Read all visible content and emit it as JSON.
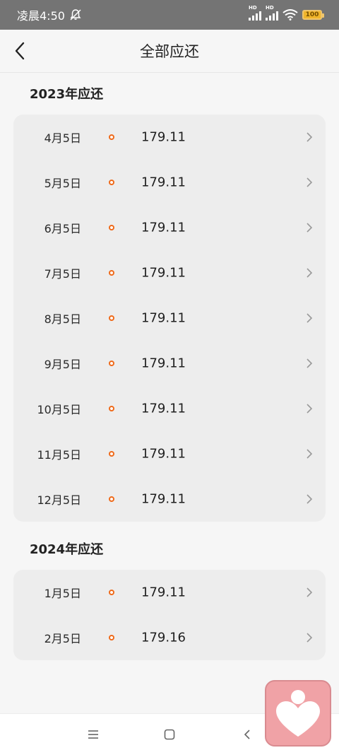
{
  "status_bar": {
    "time": "凌晨4:50",
    "signal_1_label": "HD",
    "signal_2_label": "HD",
    "battery": "100"
  },
  "header": {
    "title": "全部应还"
  },
  "sections": [
    {
      "title": "2023年应还",
      "rows": [
        {
          "date": "4月5日",
          "amount": "179.11"
        },
        {
          "date": "5月5日",
          "amount": "179.11"
        },
        {
          "date": "6月5日",
          "amount": "179.11"
        },
        {
          "date": "7月5日",
          "amount": "179.11"
        },
        {
          "date": "8月5日",
          "amount": "179.11"
        },
        {
          "date": "9月5日",
          "amount": "179.11"
        },
        {
          "date": "10月5日",
          "amount": "179.11"
        },
        {
          "date": "11月5日",
          "amount": "179.11"
        },
        {
          "date": "12月5日",
          "amount": "179.11"
        }
      ]
    },
    {
      "title": "2024年应还",
      "rows": [
        {
          "date": "1月5日",
          "amount": "179.11"
        },
        {
          "date": "2月5日",
          "amount": "179.16"
        }
      ]
    }
  ],
  "colors": {
    "accent_dot": "#ef6a1a",
    "float_widget": "#f0a2a6"
  },
  "icons": {
    "back": "chevron-left-icon",
    "row_arrow": "chevron-right-icon",
    "nav_menu": "menu-icon",
    "nav_home": "home-square-icon",
    "nav_back": "back-triangle-icon",
    "float": "heart-person-icon"
  }
}
